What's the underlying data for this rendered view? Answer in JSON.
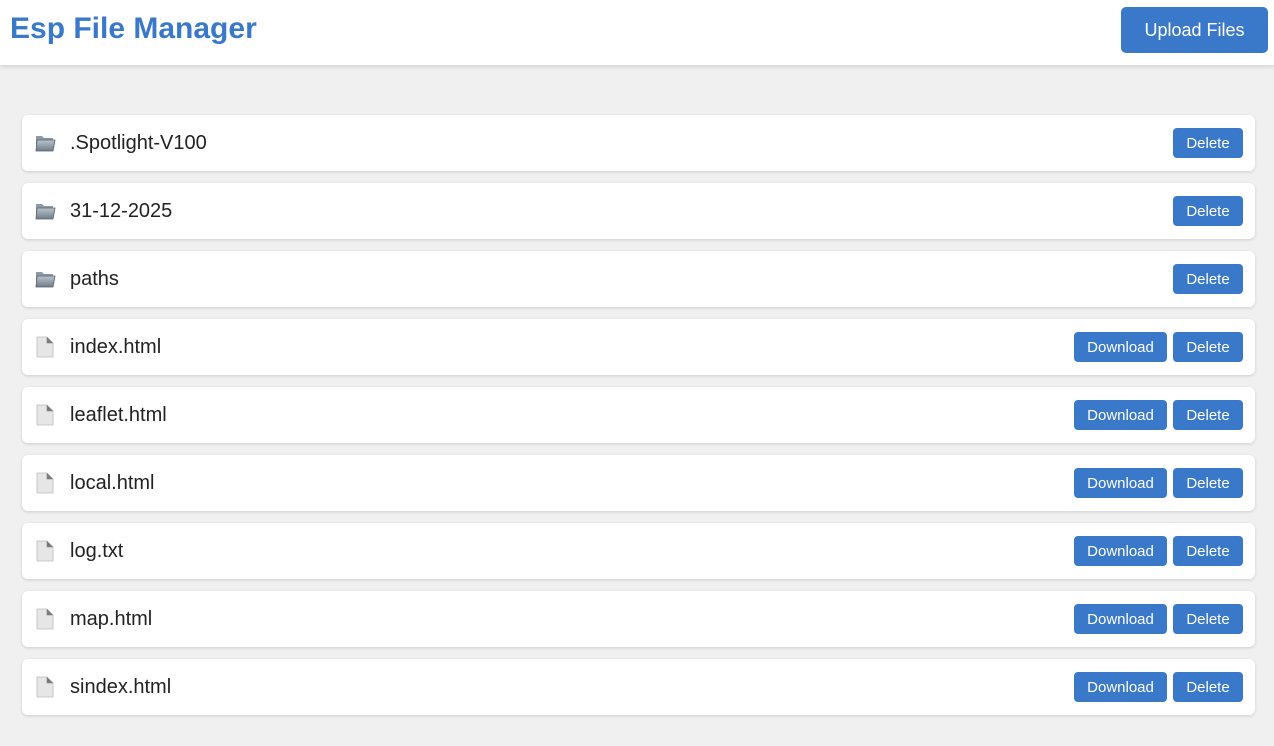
{
  "header": {
    "title": "Esp File Manager",
    "upload_label": "Upload Files"
  },
  "colors": {
    "accent": "#3a78c9",
    "background": "#f0f0f0"
  },
  "files": [
    {
      "name": ".Spotlight-V100",
      "type": "folder",
      "icon": "folder-icon",
      "download_label": "",
      "delete_label": "Delete"
    },
    {
      "name": "31-12-2025",
      "type": "folder",
      "icon": "folder-icon",
      "download_label": "",
      "delete_label": "Delete"
    },
    {
      "name": "paths",
      "type": "folder",
      "icon": "folder-icon",
      "download_label": "",
      "delete_label": "Delete"
    },
    {
      "name": "index.html",
      "type": "file",
      "icon": "file-icon",
      "download_label": "Download",
      "delete_label": "Delete"
    },
    {
      "name": "leaflet.html",
      "type": "file",
      "icon": "file-icon",
      "download_label": "Download",
      "delete_label": "Delete"
    },
    {
      "name": "local.html",
      "type": "file",
      "icon": "file-icon",
      "download_label": "Download",
      "delete_label": "Delete"
    },
    {
      "name": "log.txt",
      "type": "file",
      "icon": "file-icon",
      "download_label": "Download",
      "delete_label": "Delete"
    },
    {
      "name": "map.html",
      "type": "file",
      "icon": "file-icon",
      "download_label": "Download",
      "delete_label": "Delete"
    },
    {
      "name": "sindex.html",
      "type": "file",
      "icon": "file-icon",
      "download_label": "Download",
      "delete_label": "Delete"
    }
  ]
}
